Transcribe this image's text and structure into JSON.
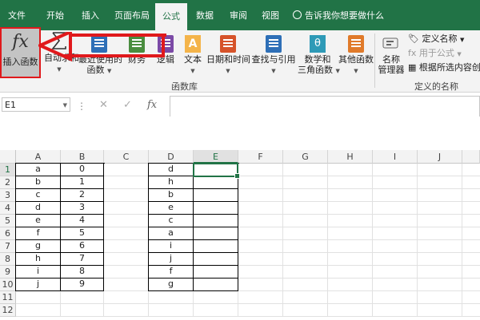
{
  "tabs": [
    "文件",
    "开始",
    "插入",
    "页面布局",
    "公式",
    "数据",
    "审阅",
    "视图"
  ],
  "active_tab": "公式",
  "tell_me": "告诉我你想要做什么",
  "ribbon": {
    "insert_function": {
      "icon_text": "fx",
      "label": "插入函数"
    },
    "autosum": {
      "label": "自动求和"
    },
    "recent": {
      "label1": "最近使用的",
      "label2": "函数"
    },
    "financial": {
      "label": "财务"
    },
    "logical": {
      "label": "逻辑"
    },
    "text": {
      "label": "文本",
      "icon_text": "A"
    },
    "datetime": {
      "label": "日期和时间"
    },
    "lookup": {
      "label": "查找与引用"
    },
    "math": {
      "label1": "数学和",
      "label2": "三角函数",
      "icon_text": "θ"
    },
    "more": {
      "label": "其他函数"
    },
    "group_library": "函数库",
    "name_manager": {
      "label1": "名称",
      "label2": "管理器"
    },
    "define_name": "定义名称",
    "use_in_formula": "用于公式",
    "create_from_selection": "根据所选内容创建",
    "group_names": "定义的名称"
  },
  "formula_bar": {
    "name_box": "E1",
    "formula": ""
  },
  "columns": [
    "A",
    "B",
    "C",
    "D",
    "E",
    "F",
    "G",
    "H",
    "I",
    "J"
  ],
  "rows": [
    "1",
    "2",
    "3",
    "4",
    "5",
    "6",
    "7",
    "8",
    "9",
    "10",
    "11",
    "12"
  ],
  "col_a": [
    "a",
    "b",
    "c",
    "d",
    "e",
    "f",
    "g",
    "h",
    "i",
    "j"
  ],
  "col_b": [
    "0",
    "1",
    "2",
    "3",
    "4",
    "5",
    "6",
    "7",
    "8",
    "9"
  ],
  "col_d": [
    "d",
    "h",
    "b",
    "e",
    "c",
    "a",
    "i",
    "j",
    "f",
    "g"
  ],
  "colors": {
    "excel_green": "#217346",
    "highlight_red": "#e0191c"
  }
}
